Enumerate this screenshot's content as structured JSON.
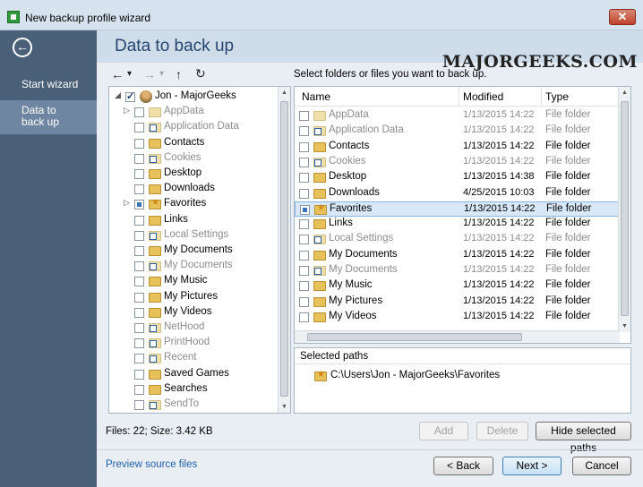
{
  "window": {
    "title": "New backup profile wizard",
    "close_glyph": "✕"
  },
  "sidebar": {
    "back_glyph": "←",
    "items": [
      {
        "label": "Start wizard"
      },
      {
        "label": "Data to back up"
      }
    ]
  },
  "header": {
    "title": "Data to back up",
    "watermark": "MAJORGEEKS.COM"
  },
  "toolbar": {
    "back_glyph": "←",
    "forward_glyph": "→",
    "up_glyph": "↑",
    "refresh_glyph": "↻",
    "dropdown_glyph": "▾"
  },
  "instructions": "Select folders or files you want to back up.",
  "tree": {
    "root_label": "Jon - MajorGeeks",
    "items": [
      {
        "label": "AppData",
        "dim": true,
        "icon": "folder",
        "expander": true
      },
      {
        "label": "Application Data",
        "dim": true,
        "icon": "shortcut"
      },
      {
        "label": "Contacts",
        "dim": false,
        "icon": "folder"
      },
      {
        "label": "Cookies",
        "dim": true,
        "icon": "shortcut"
      },
      {
        "label": "Desktop",
        "dim": false,
        "icon": "folder"
      },
      {
        "label": "Downloads",
        "dim": false,
        "icon": "folder"
      },
      {
        "label": "Favorites",
        "dim": false,
        "icon": "star",
        "expander": true,
        "state": "partial"
      },
      {
        "label": "Links",
        "dim": false,
        "icon": "folder"
      },
      {
        "label": "Local Settings",
        "dim": true,
        "icon": "shortcut"
      },
      {
        "label": "My Documents",
        "dim": false,
        "icon": "folder"
      },
      {
        "label": "My Documents",
        "dim": true,
        "icon": "shortcut"
      },
      {
        "label": "My Music",
        "dim": false,
        "icon": "folder"
      },
      {
        "label": "My Pictures",
        "dim": false,
        "icon": "folder"
      },
      {
        "label": "My Videos",
        "dim": false,
        "icon": "folder"
      },
      {
        "label": "NetHood",
        "dim": true,
        "icon": "shortcut"
      },
      {
        "label": "PrintHood",
        "dim": true,
        "icon": "shortcut"
      },
      {
        "label": "Recent",
        "dim": true,
        "icon": "shortcut"
      },
      {
        "label": "Saved Games",
        "dim": false,
        "icon": "folder"
      },
      {
        "label": "Searches",
        "dim": false,
        "icon": "folder"
      },
      {
        "label": "SendTo",
        "dim": true,
        "icon": "shortcut"
      }
    ]
  },
  "filelist": {
    "columns": {
      "name": "Name",
      "modified": "Modified",
      "type": "Type"
    },
    "rows": [
      {
        "name": "AppData",
        "modified": "1/13/2015 14:22",
        "type": "File folder",
        "dim": true,
        "icon": "folder"
      },
      {
        "name": "Application Data",
        "modified": "1/13/2015 14:22",
        "type": "File folder",
        "dim": true,
        "icon": "shortcut"
      },
      {
        "name": "Contacts",
        "modified": "1/13/2015 14:22",
        "type": "File folder",
        "dim": false,
        "icon": "folder"
      },
      {
        "name": "Cookies",
        "modified": "1/13/2015 14:22",
        "type": "File folder",
        "dim": true,
        "icon": "shortcut"
      },
      {
        "name": "Desktop",
        "modified": "1/13/2015 14:38",
        "type": "File folder",
        "dim": false,
        "icon": "folder"
      },
      {
        "name": "Downloads",
        "modified": "4/25/2015 10:03",
        "type": "File folder",
        "dim": false,
        "icon": "folder"
      },
      {
        "name": "Favorites",
        "modified": "1/13/2015 14:22",
        "type": "File folder",
        "dim": false,
        "icon": "star",
        "selected": true
      },
      {
        "name": "Links",
        "modified": "1/13/2015 14:22",
        "type": "File folder",
        "dim": false,
        "icon": "folder"
      },
      {
        "name": "Local Settings",
        "modified": "1/13/2015 14:22",
        "type": "File folder",
        "dim": true,
        "icon": "shortcut"
      },
      {
        "name": "My Documents",
        "modified": "1/13/2015 14:22",
        "type": "File folder",
        "dim": false,
        "icon": "folder"
      },
      {
        "name": "My Documents",
        "modified": "1/13/2015 14:22",
        "type": "File folder",
        "dim": true,
        "icon": "shortcut"
      },
      {
        "name": "My Music",
        "modified": "1/13/2015 14:22",
        "type": "File folder",
        "dim": false,
        "icon": "folder"
      },
      {
        "name": "My Pictures",
        "modified": "1/13/2015 14:22",
        "type": "File folder",
        "dim": false,
        "icon": "folder"
      },
      {
        "name": "My Videos",
        "modified": "1/13/2015 14:22",
        "type": "File folder",
        "dim": false,
        "icon": "folder"
      }
    ]
  },
  "selected_paths": {
    "label": "Selected paths",
    "paths": [
      "C:\\Users\\Jon - MajorGeeks\\Favorites"
    ]
  },
  "status": "Files: 22; Size: 3.42 KB",
  "buttons": {
    "add": "Add",
    "delete": "Delete",
    "hide_paths": "Hide selected paths",
    "back": "< Back",
    "next": "Next >",
    "cancel": "Cancel"
  },
  "preview_link": "Preview source files"
}
